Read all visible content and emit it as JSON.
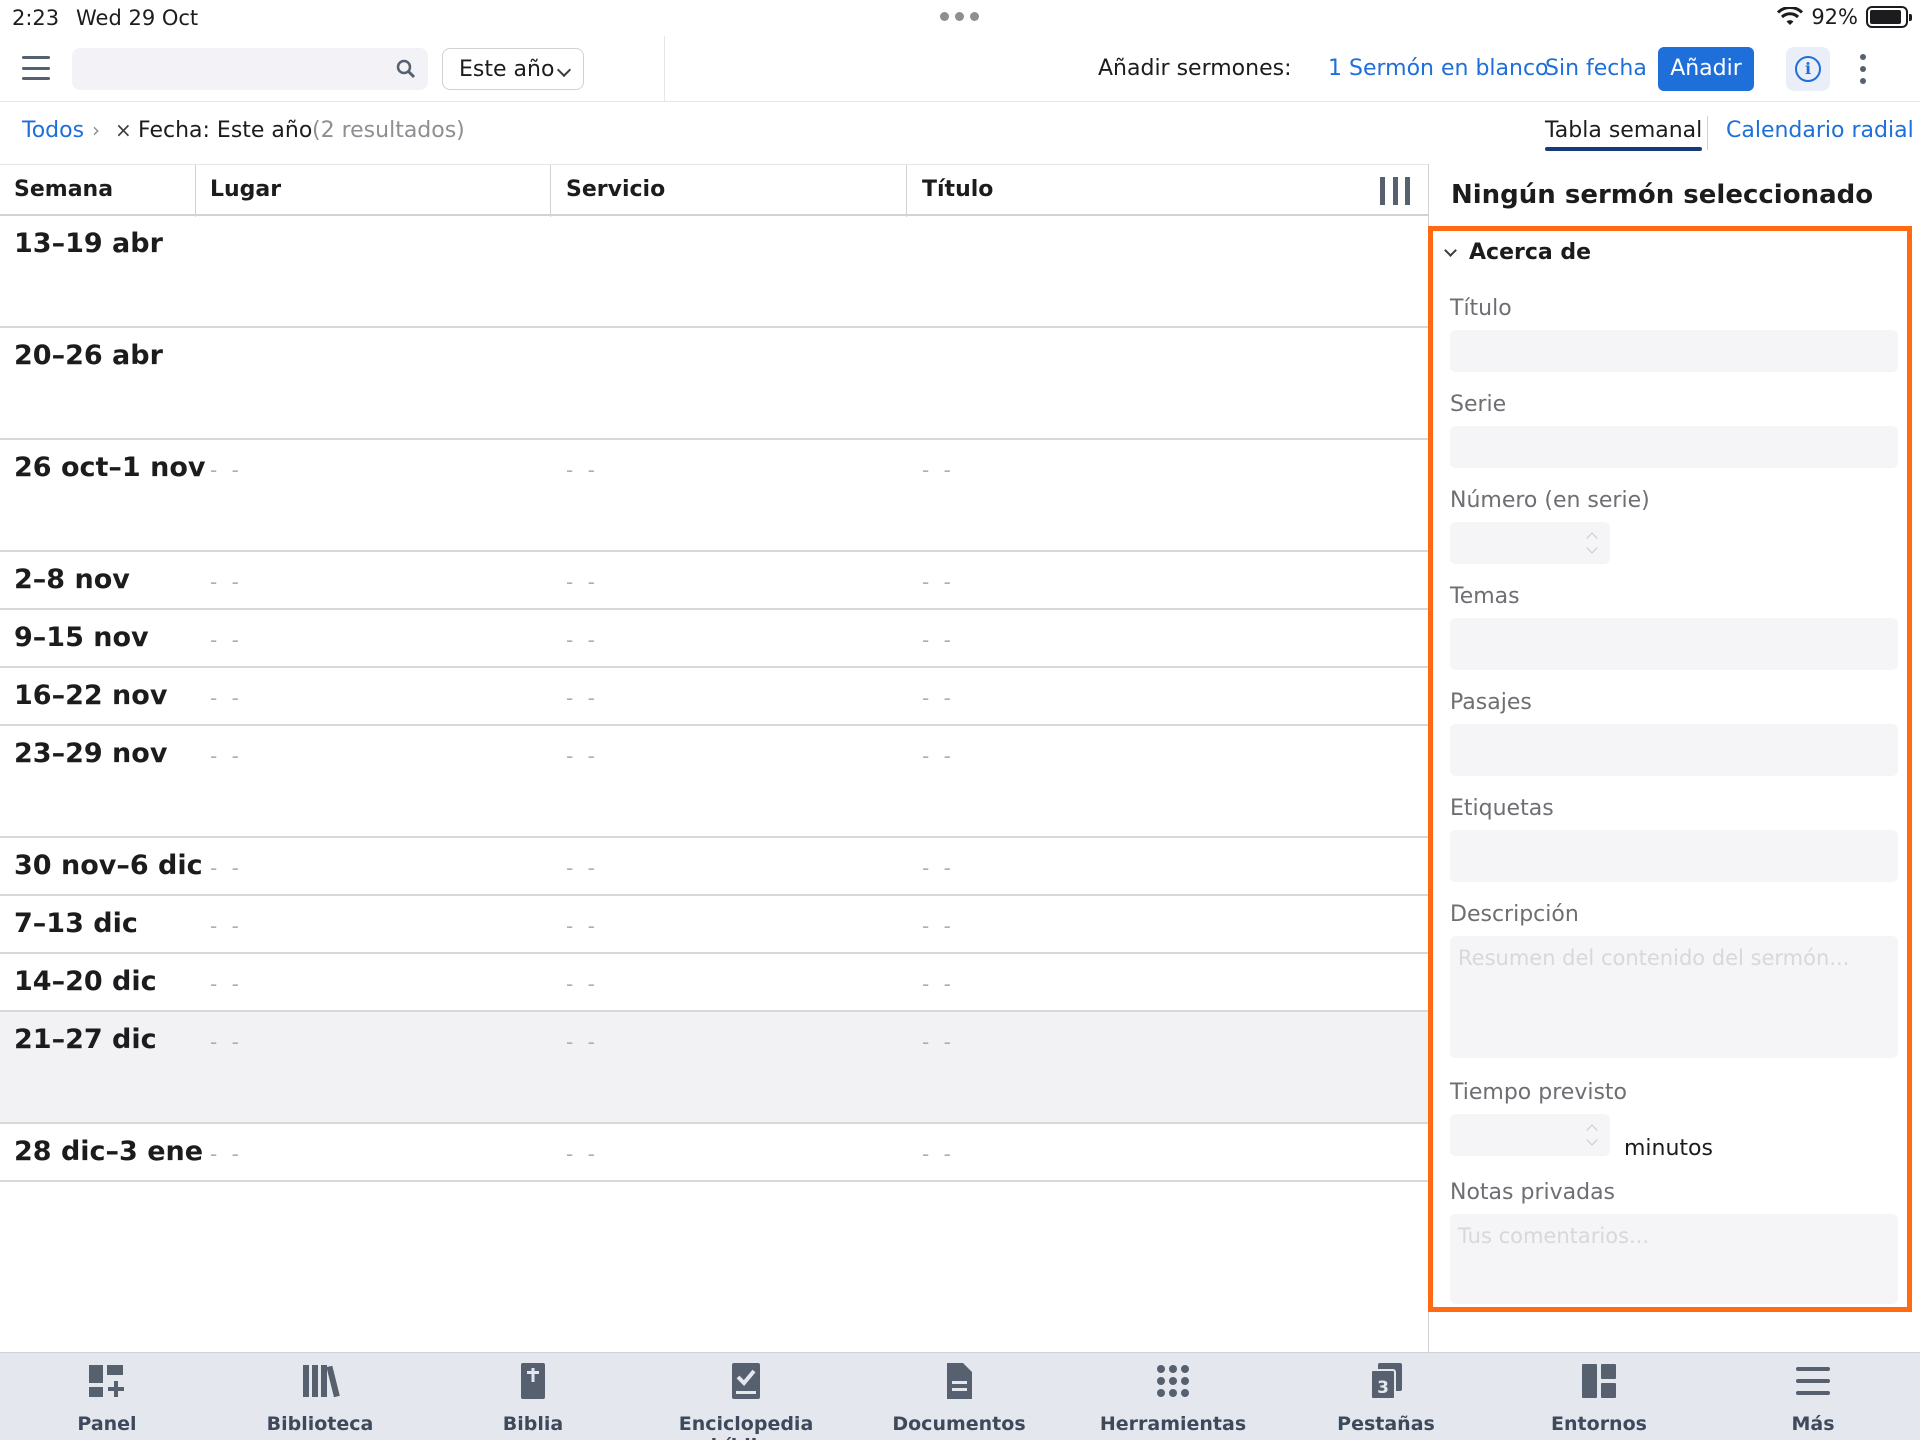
{
  "status_bar": {
    "time": "2:23",
    "date": "Wed 29 Oct",
    "battery": "92%",
    "battery_level": 0.92
  },
  "toolbar": {
    "search_placeholder": "",
    "date_filter": "Este año",
    "add_label": "Añadir sermones:",
    "add_count": "1",
    "add_blank": "Sermón en blanco",
    "add_undated": "Sin fecha",
    "add_button": "Añadir"
  },
  "filters": {
    "all": "Todos",
    "separator": "›",
    "remove": "×",
    "active_filter": "Fecha: Este año",
    "result_count": "(2 resultados)",
    "views": [
      "Tabla semanal",
      "Calendario radial"
    ]
  },
  "table": {
    "columns": [
      "Semana",
      "Lugar",
      "Servicio",
      "Título"
    ],
    "empty_value": "- -",
    "rows": [
      {
        "week": "13–19 abr",
        "empty": false
      },
      {
        "week": "20–26 abr",
        "empty": false
      },
      {
        "week": "26 oct–1 nov",
        "empty": true
      },
      {
        "week": "2–8 nov",
        "empty": true
      },
      {
        "week": "9–15 nov",
        "empty": true
      },
      {
        "week": "16–22 nov",
        "empty": true
      },
      {
        "week": "23–29 nov",
        "empty": true
      },
      {
        "week": "30 nov–6 dic",
        "empty": true
      },
      {
        "week": "7–13 dic",
        "empty": true
      },
      {
        "week": "14–20 dic",
        "empty": true
      },
      {
        "week": "21–27 dic",
        "empty": true,
        "selected": true
      },
      {
        "week": "28 dic–3 ene",
        "empty": true
      }
    ]
  },
  "panel": {
    "title": "Ningún sermón seleccionado",
    "section": "Acerca de",
    "fields": {
      "titulo": "Título",
      "serie": "Serie",
      "numero": "Número (en serie)",
      "temas": "Temas",
      "pasajes": "Pasajes",
      "etiquetas": "Etiquetas",
      "descripcion": "Descripción",
      "descripcion_placeholder": "Resumen del contenido del sermón...",
      "tiempo": "Tiempo previsto",
      "minutos": "minutos",
      "notas": "Notas privadas",
      "notas_placeholder": "Tus comentarios..."
    },
    "highlight_color": "#ff6a13"
  },
  "tabbar": {
    "items": [
      {
        "label": "Panel",
        "icon": "panel-icon"
      },
      {
        "label": "Biblioteca",
        "icon": "library-icon"
      },
      {
        "label": "Biblia",
        "icon": "bible-icon"
      },
      {
        "label": "Enciclopedia bíblica",
        "icon": "encyclopedia-icon"
      },
      {
        "label": "Documentos",
        "icon": "document-icon"
      },
      {
        "label": "Herramientas",
        "icon": "tools-grid-icon"
      },
      {
        "label": "Pestañas",
        "icon": "tabs-icon",
        "badge": "3"
      },
      {
        "label": "Entornos",
        "icon": "layouts-icon"
      },
      {
        "label": "Más",
        "icon": "more-menu-icon"
      }
    ]
  },
  "colors": {
    "accent": "#1e6fd9",
    "tabbar_bg": "#e4e8ee",
    "icon": "#56606e"
  }
}
